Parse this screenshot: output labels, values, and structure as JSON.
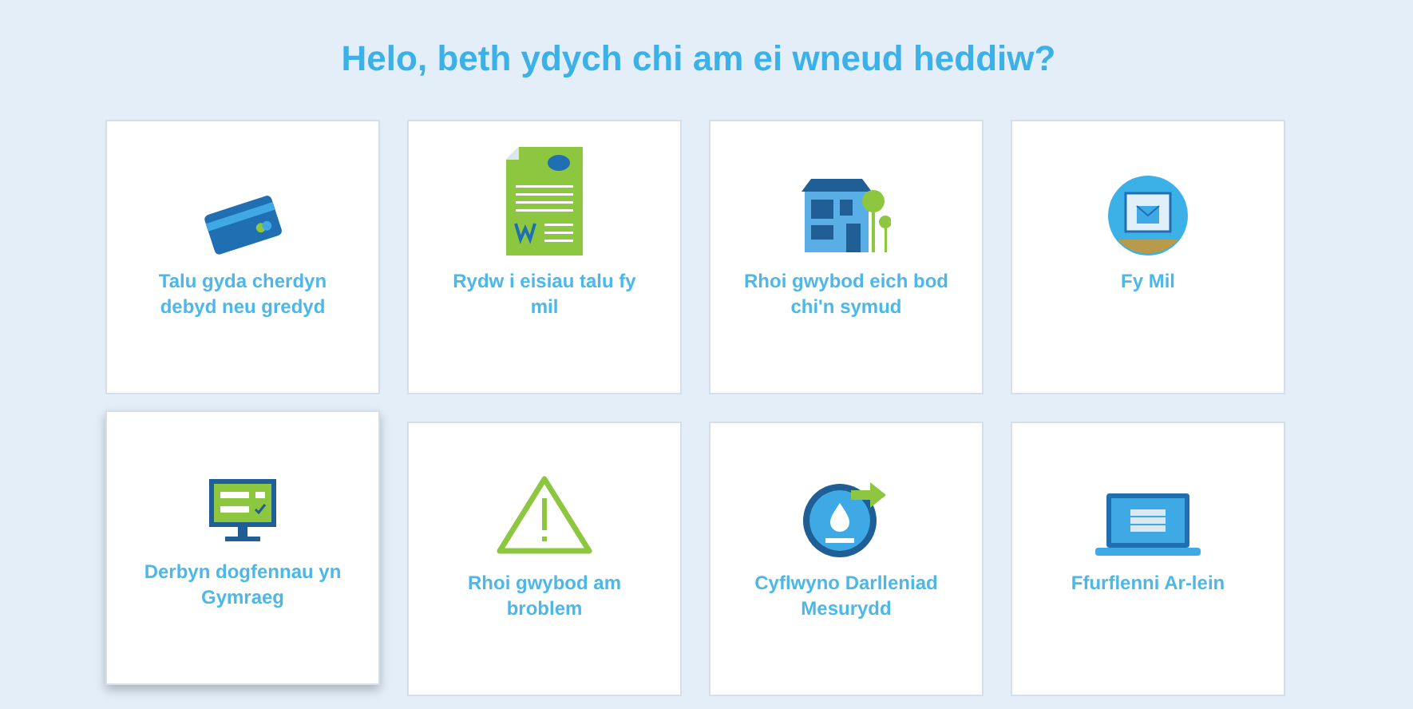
{
  "heading": "Helo, beth ydych chi am ei wneud heddiw?",
  "tiles": [
    {
      "label": "Talu gyda cherdyn debyd neu gredyd",
      "kind": "card",
      "highlighted": false
    },
    {
      "label": "Rydw i eisiau talu fy mil",
      "kind": "bill",
      "highlighted": false
    },
    {
      "label": "Rhoi gwybod eich bod chi'n symud",
      "kind": "house",
      "highlighted": false
    },
    {
      "label": "Fy Mil",
      "kind": "account",
      "highlighted": false
    },
    {
      "label": "Derbyn dogfennau yn Gymraeg",
      "kind": "monitor",
      "highlighted": true
    },
    {
      "label": "Rhoi gwybod am broblem",
      "kind": "warning",
      "highlighted": false
    },
    {
      "label": "Cyflwyno Darlleniad Mesurydd",
      "kind": "meter",
      "highlighted": false
    },
    {
      "label": "Ffurflenni Ar-lein",
      "kind": "laptop",
      "highlighted": false
    }
  ]
}
